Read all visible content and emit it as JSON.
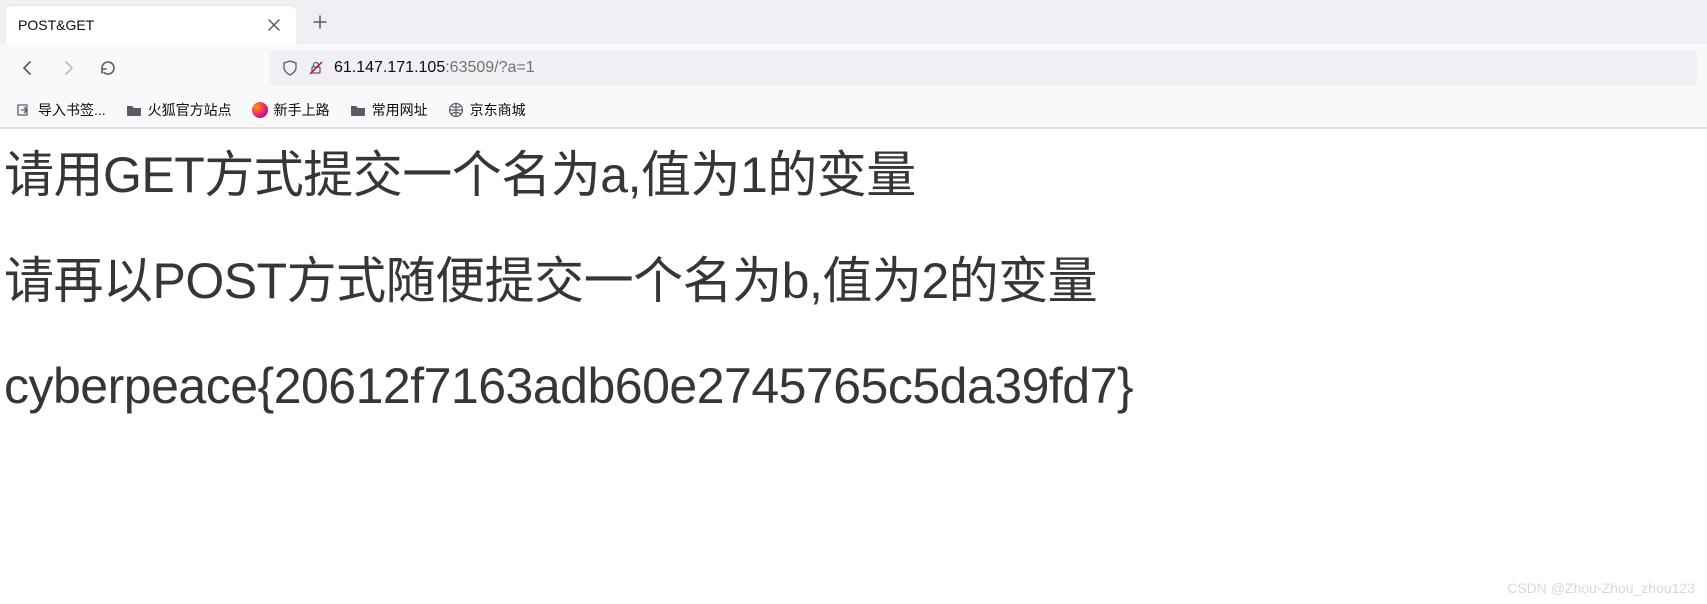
{
  "tab": {
    "title": "POST&GET"
  },
  "url": {
    "host": "61.147.171.105",
    "port_path": ":63509/?a=1"
  },
  "bookmarks": [
    {
      "label": "导入书签...",
      "icon": "import"
    },
    {
      "label": "火狐官方站点",
      "icon": "folder"
    },
    {
      "label": "新手上路",
      "icon": "firefox"
    },
    {
      "label": "常用网址",
      "icon": "folder"
    },
    {
      "label": "京东商城",
      "icon": "globe"
    }
  ],
  "page": {
    "line1": "请用GET方式提交一个名为a,值为1的变量",
    "line2": "请再以POST方式随便提交一个名为b,值为2的变量",
    "line3": "cyberpeace{20612f7163adb60e2745765c5da39fd7}"
  },
  "watermark": "CSDN @Zhou-Zhou_zhou123"
}
